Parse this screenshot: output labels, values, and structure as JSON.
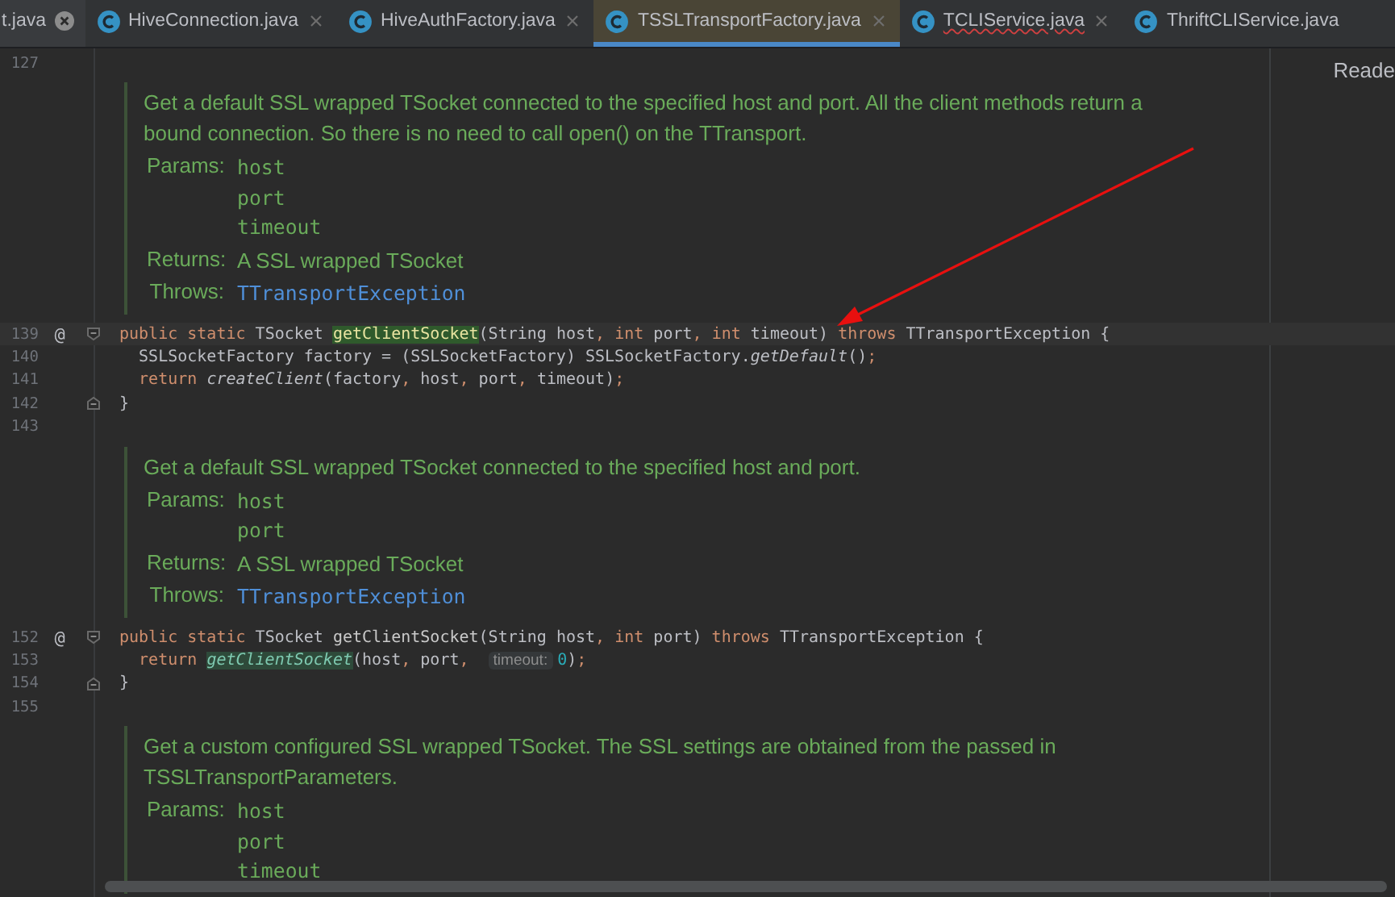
{
  "tabs": [
    {
      "label": "t.java",
      "selected": false,
      "hovered": true,
      "error": false
    },
    {
      "label": "HiveConnection.java",
      "selected": false,
      "hovered": false,
      "error": false
    },
    {
      "label": "HiveAuthFactory.java",
      "selected": false,
      "hovered": false,
      "error": false
    },
    {
      "label": "TSSLTransportFactory.java",
      "selected": true,
      "hovered": false,
      "error": false
    },
    {
      "label": "TCLIService.java",
      "selected": false,
      "hovered": false,
      "error": true
    },
    {
      "label": "ThriftCLIService.java",
      "selected": false,
      "hovered": false,
      "error": false
    }
  ],
  "reader_mode": "Reade",
  "rows": [
    {
      "kind": "code",
      "number": "127",
      "current": false,
      "fold_start": false,
      "fold_end": false,
      "tokens": []
    },
    {
      "kind": "doc",
      "text": "Get a default SSL wrapped TSocket connected to the specified host and port. All the client methods return a bound connection. So there is no need to call open() on the TTransport.",
      "params_label": "Params:",
      "params": [
        "host",
        "port",
        "timeout"
      ],
      "returns_label": "Returns:",
      "returns": "A SSL wrapped TSocket",
      "throws_label": "Throws:",
      "throws": "TTransportException"
    },
    {
      "kind": "code",
      "number": "139",
      "marker": "@",
      "fold_start": true,
      "fold_end": false,
      "current": true,
      "tokens": [
        {
          "text": "public static ",
          "kind": "kw"
        },
        {
          "text": "TSocket ",
          "kind": "text"
        },
        {
          "text": "getClientSocket",
          "kind": "fn-hl"
        },
        {
          "text": "(String host",
          "kind": "text"
        },
        {
          "text": ", ",
          "kind": "punct"
        },
        {
          "text": "int ",
          "kind": "kw"
        },
        {
          "text": "port",
          "kind": "text"
        },
        {
          "text": ", ",
          "kind": "punct"
        },
        {
          "text": "int ",
          "kind": "kw"
        },
        {
          "text": "timeout) ",
          "kind": "text"
        },
        {
          "text": "throws ",
          "kind": "kw"
        },
        {
          "text": "TTransportException {",
          "kind": "text"
        }
      ]
    },
    {
      "kind": "code",
      "number": "140",
      "current": false,
      "fold_start": false,
      "fold_end": false,
      "tokens": [
        {
          "text": "  SSLSocketFactory factory = (SSLSocketFactory) SSLSocketFactory.",
          "kind": "text"
        },
        {
          "text": "getDefault",
          "kind": "italic"
        },
        {
          "text": "()",
          "kind": "text"
        },
        {
          "text": ";",
          "kind": "punct"
        }
      ]
    },
    {
      "kind": "code",
      "number": "141",
      "current": false,
      "fold_start": false,
      "fold_end": false,
      "tokens": [
        {
          "text": "  return ",
          "kind": "kw"
        },
        {
          "text": "createClient",
          "kind": "italic"
        },
        {
          "text": "(factory",
          "kind": "text"
        },
        {
          "text": ", ",
          "kind": "punct"
        },
        {
          "text": "host",
          "kind": "text"
        },
        {
          "text": ", ",
          "kind": "punct"
        },
        {
          "text": "port",
          "kind": "text"
        },
        {
          "text": ", ",
          "kind": "punct"
        },
        {
          "text": "timeout)",
          "kind": "text"
        },
        {
          "text": ";",
          "kind": "punct"
        }
      ]
    },
    {
      "kind": "code",
      "number": "142",
      "fold_start": false,
      "fold_end": true,
      "current": false,
      "tokens": [
        {
          "text": "}",
          "kind": "text"
        }
      ]
    },
    {
      "kind": "code",
      "number": "143",
      "current": false,
      "fold_start": false,
      "fold_end": false,
      "tokens": []
    },
    {
      "kind": "doc",
      "text": "Get a default SSL wrapped TSocket connected to the specified host and port.",
      "params_label": "Params:",
      "params": [
        "host",
        "port"
      ],
      "returns_label": "Returns:",
      "returns": "A SSL wrapped TSocket",
      "throws_label": "Throws:",
      "throws": "TTransportException"
    },
    {
      "kind": "code",
      "number": "152",
      "marker": "@",
      "fold_start": true,
      "fold_end": false,
      "current": false,
      "tokens": [
        {
          "text": "public static ",
          "kind": "kw"
        },
        {
          "text": "TSocket ",
          "kind": "text"
        },
        {
          "text": "getClientSocket",
          "kind": "fn"
        },
        {
          "text": "(String host",
          "kind": "text"
        },
        {
          "text": ", ",
          "kind": "punct"
        },
        {
          "text": "int ",
          "kind": "kw"
        },
        {
          "text": "port) ",
          "kind": "text"
        },
        {
          "text": "throws ",
          "kind": "kw"
        },
        {
          "text": "TTransportException {",
          "kind": "text"
        }
      ]
    },
    {
      "kind": "code",
      "number": "153",
      "current": false,
      "fold_start": false,
      "fold_end": false,
      "tokens": [
        {
          "text": "  return ",
          "kind": "kw"
        },
        {
          "text": "getClientSocket",
          "kind": "italic-hl"
        },
        {
          "text": "(host",
          "kind": "text"
        },
        {
          "text": ", ",
          "kind": "punct"
        },
        {
          "text": "port",
          "kind": "text"
        },
        {
          "text": ", ",
          "kind": "punct"
        },
        {
          "text": "timeout:",
          "kind": "hint"
        },
        {
          "text": "0",
          "kind": "num"
        },
        {
          "text": ")",
          "kind": "text"
        },
        {
          "text": ";",
          "kind": "punct"
        }
      ]
    },
    {
      "kind": "code",
      "number": "154",
      "fold_start": false,
      "fold_end": true,
      "current": false,
      "tokens": [
        {
          "text": "}",
          "kind": "text"
        }
      ]
    },
    {
      "kind": "code",
      "number": "155",
      "current": false,
      "fold_start": false,
      "fold_end": false,
      "tokens": []
    },
    {
      "kind": "doc",
      "text": "Get a custom configured SSL wrapped TSocket. The SSL settings are obtained from the passed in TSSLTransportParameters.",
      "params_label": "Params:",
      "params": [
        "host",
        "port",
        "timeout"
      ]
    }
  ]
}
